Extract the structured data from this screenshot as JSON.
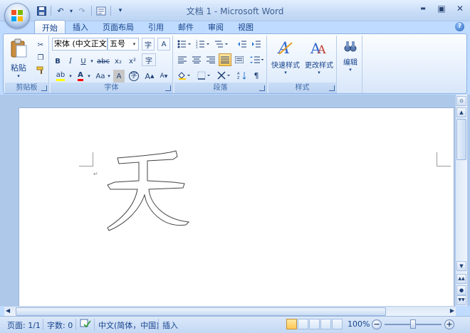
{
  "window": {
    "title": "文档 1 - Microsoft Word",
    "minimize": "▬",
    "maximize": "▣",
    "close": "✕"
  },
  "qat": {
    "undo": "↶",
    "redo": "↷",
    "dropdown": "▾"
  },
  "tabs": [
    {
      "label": "开始",
      "active": true
    },
    {
      "label": "插入"
    },
    {
      "label": "页面布局"
    },
    {
      "label": "引用"
    },
    {
      "label": "邮件"
    },
    {
      "label": "审阅"
    },
    {
      "label": "视图"
    }
  ],
  "ribbon": {
    "clipboard": {
      "label": "剪贴板",
      "paste": "粘贴"
    },
    "font": {
      "label": "字体",
      "font_name": "宋体 (中文正文",
      "font_size": "五号",
      "bold": "B",
      "italic": "I",
      "underline": "U",
      "strike": "abc",
      "subscript": "x₂",
      "superscript": "x²",
      "grow": "A",
      "shrink": "A",
      "change_case": "Aa",
      "font_color": "A",
      "highlight": "ab",
      "phonetic": "A",
      "char_border": "A",
      "enclose": "字",
      "clear_format": "字"
    },
    "paragraph": {
      "label": "段落"
    },
    "styles": {
      "label": "样式",
      "quick_styles": "快速样式",
      "change_styles": "更改样式"
    },
    "editing": {
      "label": "编辑"
    }
  },
  "document": {
    "paragraph_mark": "↵",
    "glyph_char": "天"
  },
  "status": {
    "page": "页面: 1/1",
    "words": "字数: 0",
    "language": "中文(简体，中国)",
    "insert": "插入",
    "zoom": "100%",
    "zoom_minus": "−",
    "zoom_plus": "+"
  },
  "colors": {
    "ribbon_text": "#15428b",
    "highlight": "#ffff00",
    "font_color": "#ff0000"
  }
}
